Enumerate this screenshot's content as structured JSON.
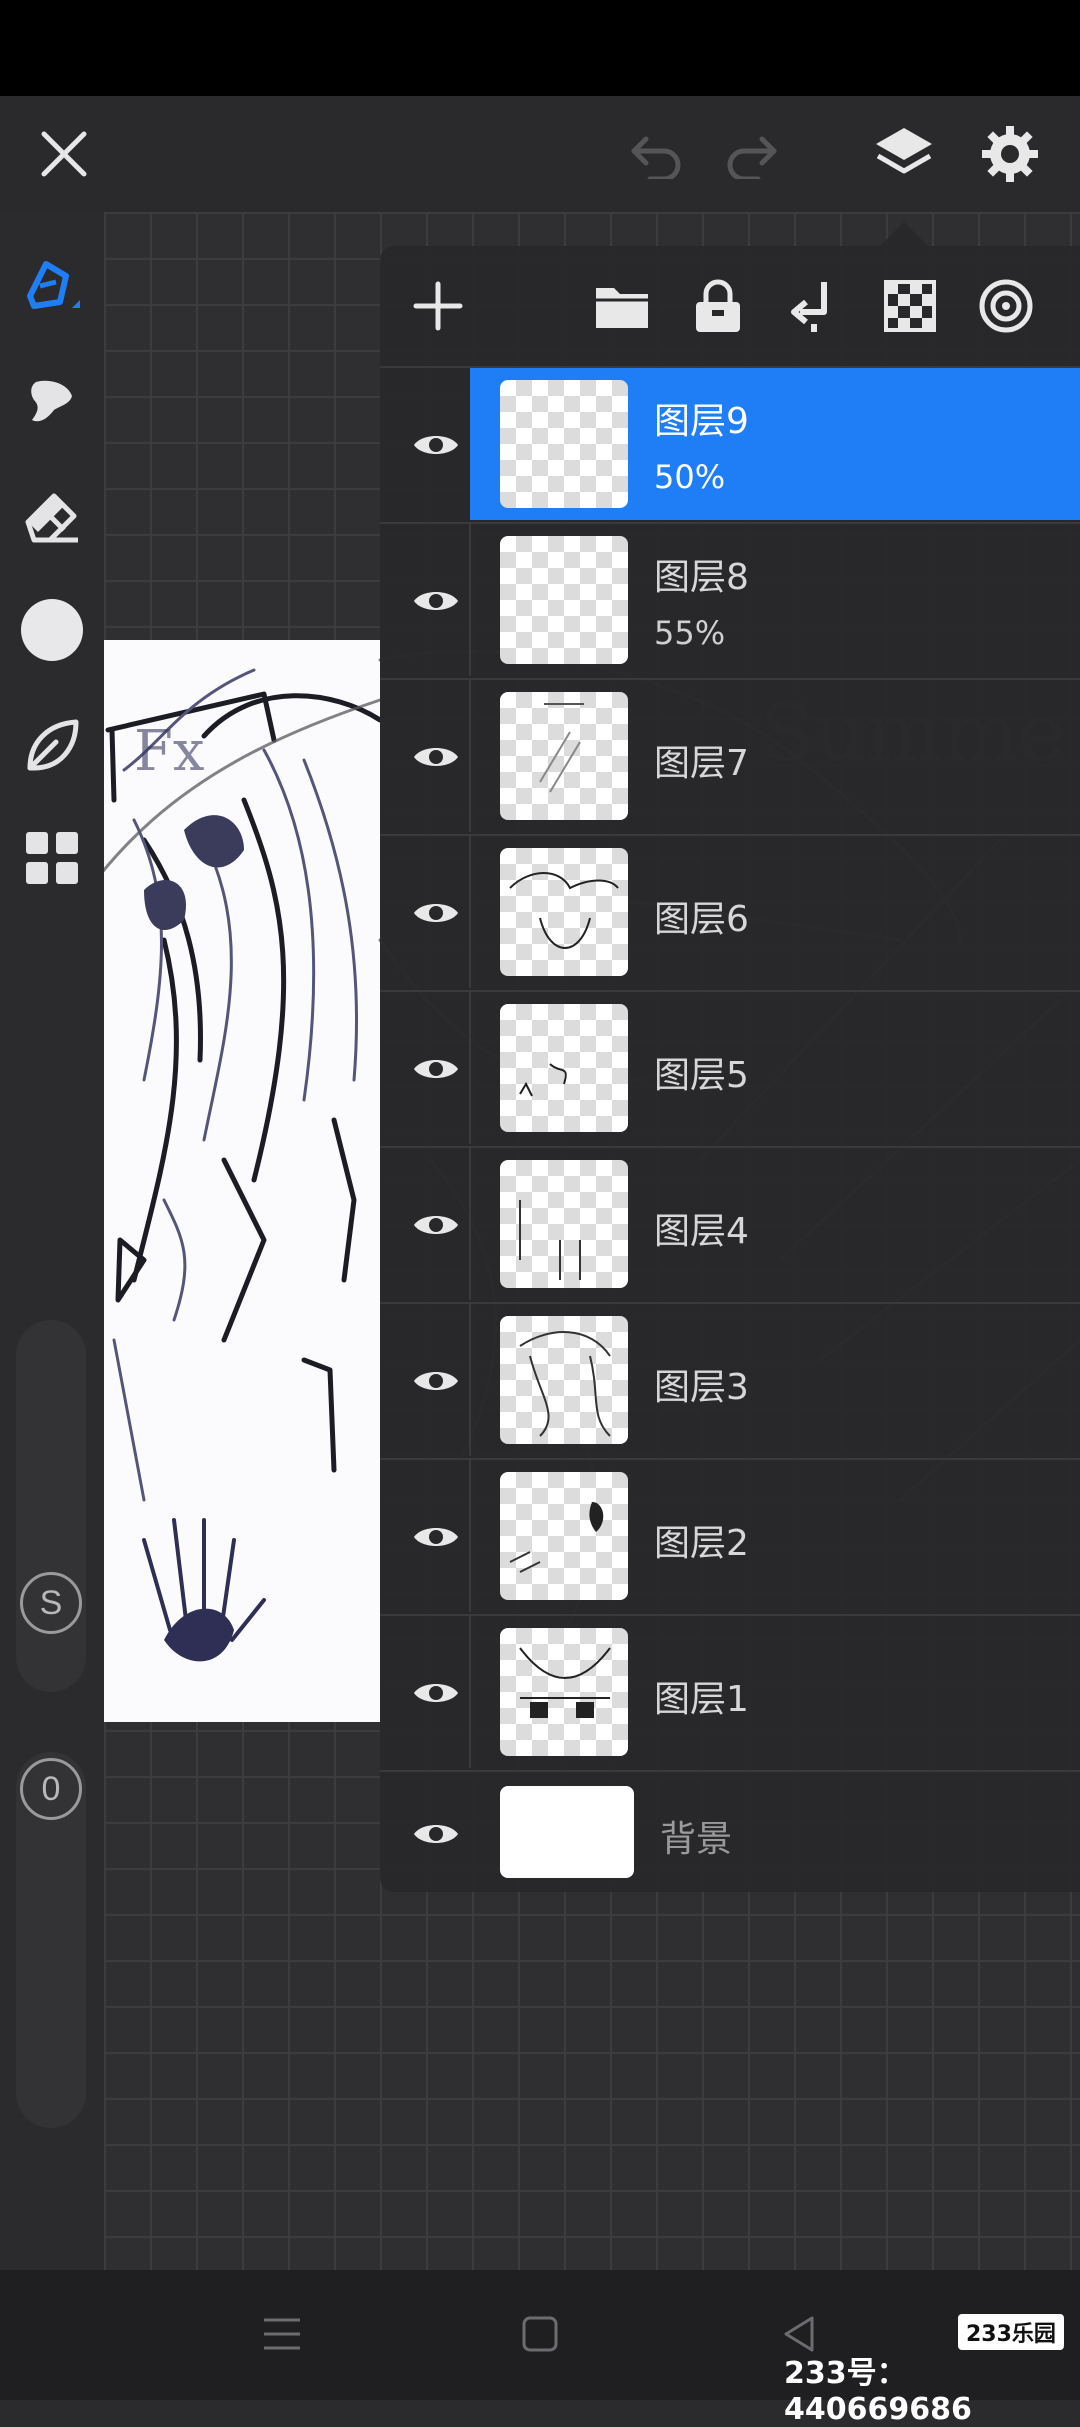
{
  "topbar": {
    "icons": [
      "close-icon",
      "undo-icon",
      "redo-icon",
      "layers-icon",
      "gear-icon"
    ]
  },
  "toolbar": {
    "tools": [
      "brush-icon",
      "smudge-icon",
      "eraser-icon",
      "color-swatch",
      "leaf-icon",
      "grid-icon"
    ],
    "size_label": "S",
    "opacity_label": "0"
  },
  "layers_panel": {
    "actions": [
      "add-icon",
      "folder-icon",
      "lock-icon",
      "merge-down-icon",
      "transparency-icon",
      "blend-icon"
    ],
    "layers": [
      {
        "name": "图层9",
        "opacity": "50%",
        "selected": true
      },
      {
        "name": "图层8",
        "opacity": "55%",
        "selected": false
      },
      {
        "name": "图层7",
        "opacity": "",
        "selected": false
      },
      {
        "name": "图层6",
        "opacity": "",
        "selected": false
      },
      {
        "name": "图层5",
        "opacity": "",
        "selected": false
      },
      {
        "name": "图层4",
        "opacity": "",
        "selected": false
      },
      {
        "name": "图层3",
        "opacity": "",
        "selected": false
      },
      {
        "name": "图层2",
        "opacity": "",
        "selected": false
      },
      {
        "name": "图层1",
        "opacity": "",
        "selected": false
      }
    ],
    "background_layer": {
      "name": "背景"
    }
  },
  "navbar": {
    "icons": [
      "menu-icon",
      "home-icon",
      "back-icon"
    ]
  },
  "watermark": {
    "text": "233号：440669686",
    "logo": "233乐园"
  },
  "colors": {
    "accent": "#1f7ef5",
    "panel_bg": "#28282a",
    "canvas_bg": "#2f2f31"
  }
}
